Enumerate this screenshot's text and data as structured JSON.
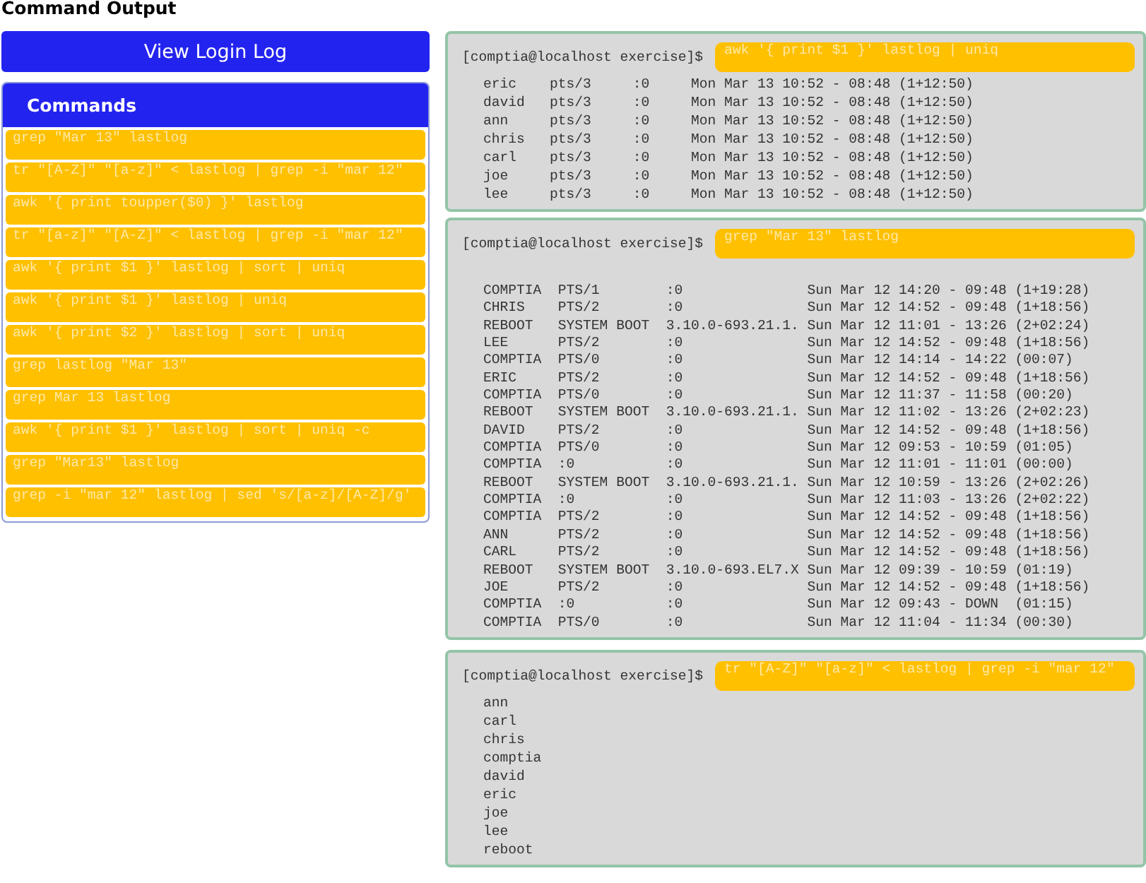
{
  "title": "Command Output",
  "view_button": "View Login Log",
  "commands": {
    "heading": "Commands",
    "items": [
      "grep \"Mar 13\" lastlog",
      "tr \"[A-Z]\" \"[a-z]\" < lastlog | grep -i \"mar 12\"",
      "awk '{ print toupper($0) }' lastlog",
      "tr \"[a-z]\" \"[A-Z]\" < lastlog | grep -i \"mar 12\"",
      "awk '{ print $1 }' lastlog | sort | uniq",
      "awk '{ print $1 }' lastlog | uniq",
      "awk '{ print $2 }' lastlog | sort | uniq",
      "grep lastlog \"Mar 13\"",
      "grep Mar 13 lastlog",
      "awk '{ print $1 }' lastlog | sort | uniq -c",
      "grep \"Mar13\" lastlog",
      "grep -i \"mar 12\" lastlog | sed 's/[a-z]/[A-Z]/g'"
    ]
  },
  "outputs": [
    {
      "prompt": "[comptia@localhost exercise]$",
      "command": "awk '{ print $1 }' lastlog | uniq",
      "lines": [
        "eric    pts/3     :0     Mon Mar 13 10:52 - 08:48 (1+12:50)",
        "david   pts/3     :0     Mon Mar 13 10:52 - 08:48 (1+12:50)",
        "ann     pts/3     :0     Mon Mar 13 10:52 - 08:48 (1+12:50)",
        "chris   pts/3     :0     Mon Mar 13 10:52 - 08:48 (1+12:50)",
        "carl    pts/3     :0     Mon Mar 13 10:52 - 08:48 (1+12:50)",
        "joe     pts/3     :0     Mon Mar 13 10:52 - 08:48 (1+12:50)",
        "lee     pts/3     :0     Mon Mar 13 10:52 - 08:48 (1+12:50)"
      ]
    },
    {
      "prompt": "[comptia@localhost exercise]$",
      "command": "grep \"Mar 13\" lastlog",
      "lines": [
        "COMPTIA  PTS/1        :0               Sun Mar 12 14:20 - 09:48 (1+19:28)",
        "CHRIS    PTS/2        :0               Sun Mar 12 14:52 - 09:48 (1+18:56)",
        "REBOOT   SYSTEM BOOT  3.10.0-693.21.1. Sun Mar 12 11:01 - 13:26 (2+02:24)",
        "LEE      PTS/2        :0               Sun Mar 12 14:52 - 09:48 (1+18:56)",
        "COMPTIA  PTS/0        :0               Sun Mar 12 14:14 - 14:22 (00:07)",
        "ERIC     PTS/2        :0               Sun Mar 12 14:52 - 09:48 (1+18:56)",
        "COMPTIA  PTS/0        :0               Sun Mar 12 11:37 - 11:58 (00:20)",
        "REBOOT   SYSTEM BOOT  3.10.0-693.21.1. Sun Mar 12 11:02 - 13:26 (2+02:23)",
        "DAVID    PTS/2        :0               Sun Mar 12 14:52 - 09:48 (1+18:56)",
        "COMPTIA  PTS/0        :0               Sun Mar 12 09:53 - 10:59 (01:05)",
        "COMPTIA  :0           :0               Sun Mar 12 11:01 - 11:01 (00:00)",
        "REBOOT   SYSTEM BOOT  3.10.0-693.21.1. Sun Mar 12 10:59 - 13:26 (2+02:26)",
        "COMPTIA  :0           :0               Sun Mar 12 11:03 - 13:26 (2+02:22)",
        "COMPTIA  PTS/2        :0               Sun Mar 12 14:52 - 09:48 (1+18:56)",
        "ANN      PTS/2        :0               Sun Mar 12 14:52 - 09:48 (1+18:56)",
        "CARL     PTS/2        :0               Sun Mar 12 14:52 - 09:48 (1+18:56)",
        "REBOOT   SYSTEM BOOT  3.10.0-693.EL7.X Sun Mar 12 09:39 - 10:59 (01:19)",
        "JOE      PTS/2        :0               Sun Mar 12 14:52 - 09:48 (1+18:56)",
        "COMPTIA  :0           :0               Sun Mar 12 09:43 - DOWN  (01:15)",
        "COMPTIA  PTS/0        :0               Sun Mar 12 11:04 - 11:34 (00:30)"
      ]
    },
    {
      "prompt": "[comptia@localhost exercise]$",
      "command": "tr \"[A-Z]\" \"[a-z]\" < lastlog | grep -i \"mar 12\"",
      "lines": [
        "ann",
        "carl",
        "chris",
        "comptia",
        "david",
        "eric",
        "joe",
        "lee",
        "reboot"
      ]
    }
  ]
}
